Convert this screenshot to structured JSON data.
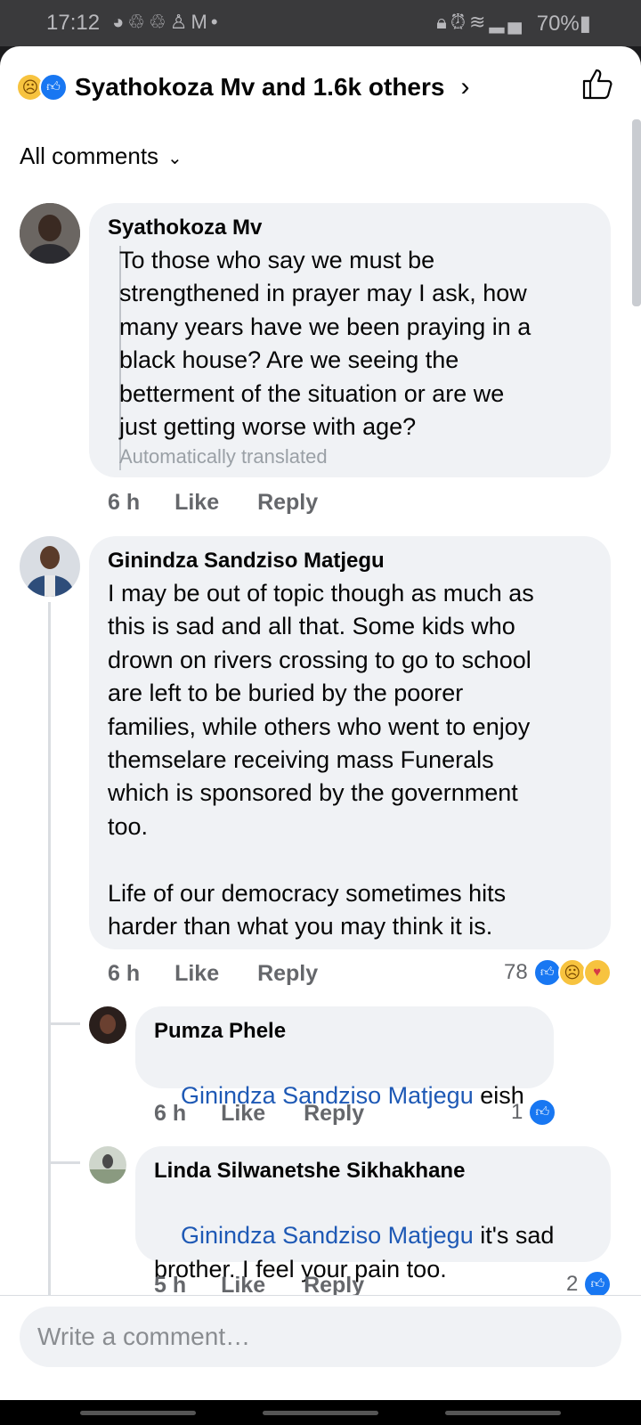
{
  "status_bar": {
    "time": "17:12",
    "left_icons": [
      "messenger-icon",
      "sync-icon",
      "sync-icon",
      "accessibility-icon",
      "gmail-icon",
      "dot-icon"
    ],
    "right_icons": [
      "lock-icon",
      "alarm-icon",
      "wifi-icon",
      "signal-icon"
    ],
    "battery": "70%"
  },
  "header": {
    "reactions": [
      "sad-emoji",
      "like-emoji"
    ],
    "title": "Syathokoza Mv and 1.6k others"
  },
  "filter": {
    "label": "All comments"
  },
  "comments": [
    {
      "author": "Syathokoza Mv",
      "text": "To those who say we must be\nstrengthened in prayer may I ask, how\nmany years have we been praying in a\nblack house? Are we seeing the\nbetterment of the situation or are we\njust getting worse with age?",
      "translated_note": "Automatically translated",
      "time": "6 h",
      "like_label": "Like",
      "reply_label": "Reply"
    },
    {
      "author": "Ginindza Sandziso Matjegu",
      "text": "I may be out of topic though as much as\nthis is sad and all that. Some kids who\ndrown on rivers crossing to go to school\nare left to be buried by the poorer\nfamilies, while others who went to enjoy\nthemselare receiving mass Funerals\nwhich is sponsored by the government\ntoo.\n\nLife of our democracy sometimes hits\nharder than what you may think it is.",
      "time": "6 h",
      "like_label": "Like",
      "reply_label": "Reply",
      "reaction_count": "78",
      "reactions": [
        "like-emoji",
        "sad-emoji",
        "care-emoji"
      ]
    }
  ],
  "replies": [
    {
      "author": "Pumza Phele",
      "mention": "Ginindza Sandziso Matjegu",
      "text": " eish",
      "time": "6 h",
      "like_label": "Like",
      "reply_label": "Reply",
      "reaction_count": "1"
    },
    {
      "author": "Linda Silwanetshe Sikhakhane",
      "mention": "Ginindza Sandziso Matjegu",
      "text": " it's sad\nbrother. I feel your pain too.",
      "time": "5 h",
      "like_label": "Like",
      "reply_label": "Reply",
      "reaction_count": "2"
    }
  ],
  "composer": {
    "placeholder": "Write a comment…"
  },
  "colors": {
    "link": "#1e59b5",
    "like_blue": "#1877f2",
    "bubble": "#f0f2f5",
    "meta": "#65676b"
  }
}
